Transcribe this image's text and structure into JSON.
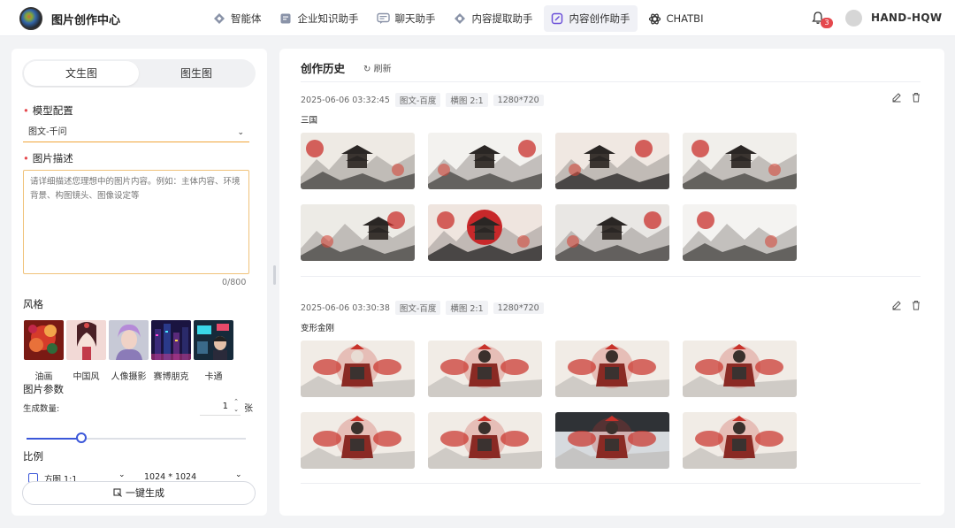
{
  "app": {
    "title": "图片创作中心"
  },
  "nav": [
    {
      "label": "智能体",
      "icon": "agent-icon"
    },
    {
      "label": "企业知识助手",
      "icon": "knowledge-icon"
    },
    {
      "label": "聊天助手",
      "icon": "chat-icon"
    },
    {
      "label": "内容提取助手",
      "icon": "extract-icon"
    },
    {
      "label": "内容创作助手",
      "icon": "create-icon",
      "active": true
    },
    {
      "label": "CHATBI",
      "icon": "openai-icon"
    }
  ],
  "notifications": {
    "count": "3"
  },
  "user": {
    "name": "HAND-HQW"
  },
  "left": {
    "tabs": [
      "文生图",
      "图生图"
    ],
    "model_label": "模型配置",
    "model_value": "图文-千问",
    "desc_label": "图片描述",
    "desc_placeholder": "请详细描述您理想中的图片内容。例如：主体内容、环境背景、构图镜头、图像设定等",
    "counter": "0/800",
    "style_label": "风格",
    "styles": [
      "油画",
      "中国风",
      "人像摄影",
      "赛博朋克",
      "卡通"
    ],
    "params_label": "图片参数",
    "count_label": "生成数量:",
    "count_value": "1",
    "count_unit": "张",
    "slider_value": 0.25,
    "ratio_label": "比例",
    "ratio_value": "方图 1:1",
    "size_value": "1024 * 1024",
    "generate_label": "一键生成"
  },
  "history": {
    "title": "创作历史",
    "refresh_label": "刷新",
    "groups": [
      {
        "time": "2025-06-06 03:32:45",
        "tags": [
          "图文-百度",
          "横图 2:1",
          "1280*720"
        ],
        "prompt": "三国",
        "theme": "ink-architecture"
      },
      {
        "time": "2025-06-06 03:30:38",
        "tags": [
          "图文-百度",
          "横图 2:1",
          "1280*720"
        ],
        "prompt": "变形金刚",
        "theme": "red-warrior"
      }
    ]
  },
  "colors": {
    "accent": "#3b57d9",
    "required": "#e5484d",
    "focus_border": "#f0a63a"
  }
}
